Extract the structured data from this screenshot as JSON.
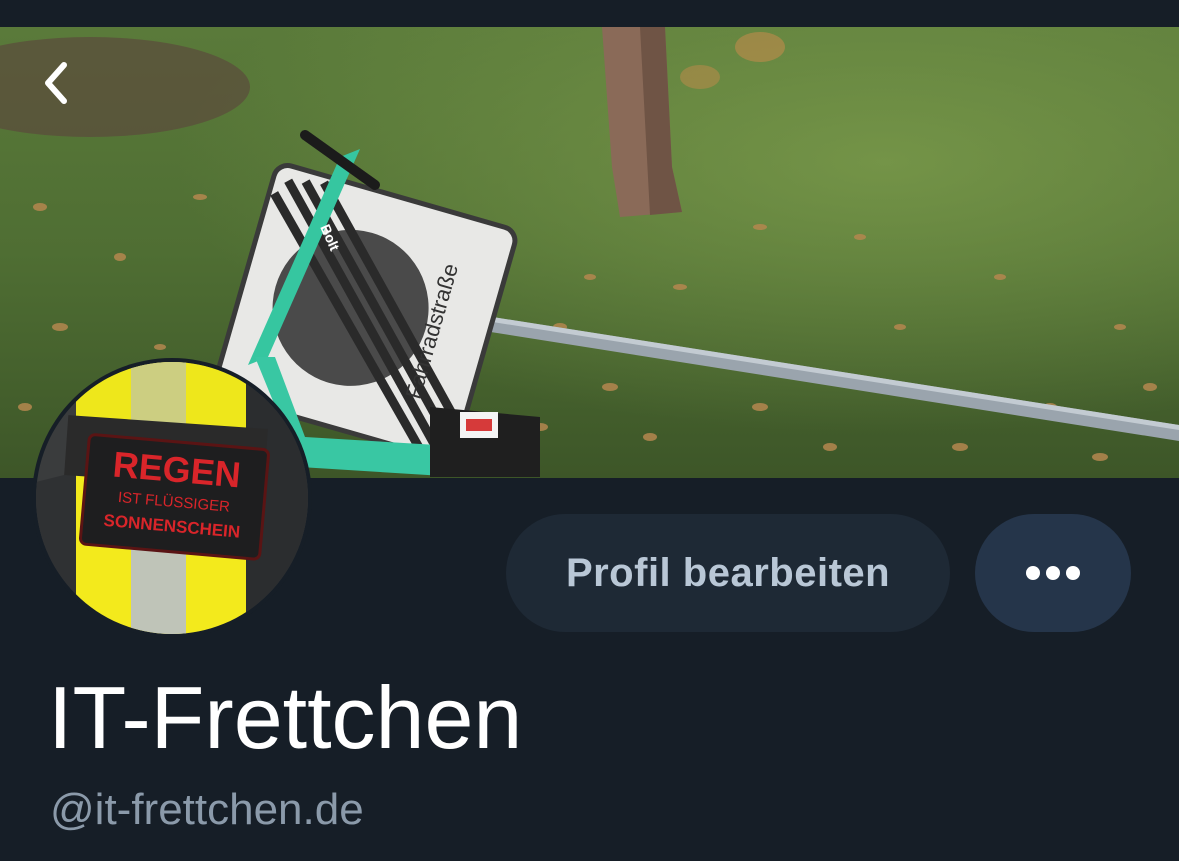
{
  "header": {
    "back_icon": "chevron-left-icon",
    "banner_sign_text": "Fahrradstraße",
    "banner_scooter_brand": "Bolt"
  },
  "avatar": {
    "patch_line1": "REGEN",
    "patch_line2": "IST FLÜSSIGER",
    "patch_line3": "SONNENSCHEIN"
  },
  "actions": {
    "edit_profile_label": "Profil bearbeiten",
    "more_icon": "ellipsis-icon"
  },
  "profile": {
    "display_name": "IT-Frettchen",
    "handle": "@it-frettchen.de"
  },
  "colors": {
    "background": "#161e27",
    "button_bg": "#1e2935",
    "more_button_bg": "#25354a",
    "button_text": "#b9c7d6",
    "name_text": "#ffffff",
    "handle_text": "#8b9aaa"
  }
}
